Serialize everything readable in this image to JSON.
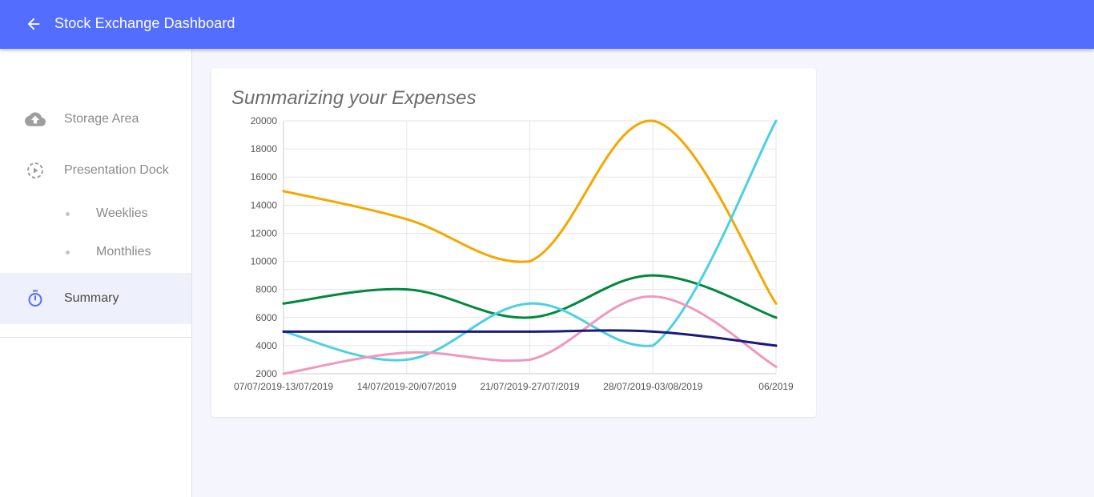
{
  "appbar": {
    "title": "Stock Exchange Dashboard",
    "back_icon": "arrow-left-icon"
  },
  "sidebar": {
    "items": [
      {
        "label": "Storage Area",
        "icon": "cloud-upload-icon"
      },
      {
        "label": "Presentation Dock",
        "icon": "play-circle-dashed-icon"
      },
      {
        "label": "Weeklies"
      },
      {
        "label": "Monthlies"
      },
      {
        "label": "Summary",
        "icon": "timer-icon",
        "active": true
      }
    ]
  },
  "colors": {
    "appbar": "#536dfe",
    "active_nav_bg": "#eef0fb",
    "active_icon": "#536dfe"
  },
  "card": {
    "title": "Summarizing your Expenses"
  },
  "chart_data": {
    "type": "line",
    "title": "Summarizing your Expenses",
    "categories": [
      "07/07/2019-13/07/2019",
      "14/07/2019-20/07/2019",
      "21/07/2019-27/07/2019",
      "28/07/2019-03/08/2019",
      "06/2019"
    ],
    "ylim": [
      2000,
      20000
    ],
    "yticks": [
      2000,
      4000,
      6000,
      8000,
      10000,
      12000,
      14000,
      16000,
      18000,
      20000
    ],
    "grid": true,
    "series": [
      {
        "color": "#f7a600",
        "values": [
          15000,
          13000,
          10000,
          20000,
          7000
        ]
      },
      {
        "color": "#00893d",
        "values": [
          7000,
          8000,
          6000,
          9000,
          6000
        ]
      },
      {
        "color": "#4dd0e1",
        "values": [
          5000,
          3000,
          7000,
          4000,
          20000
        ]
      },
      {
        "color": "#f197bd",
        "values": [
          2000,
          3500,
          3000,
          7500,
          2500
        ]
      },
      {
        "color": "#1a1a7a",
        "values": [
          5000,
          5000,
          5000,
          5000,
          4000
        ]
      }
    ]
  }
}
